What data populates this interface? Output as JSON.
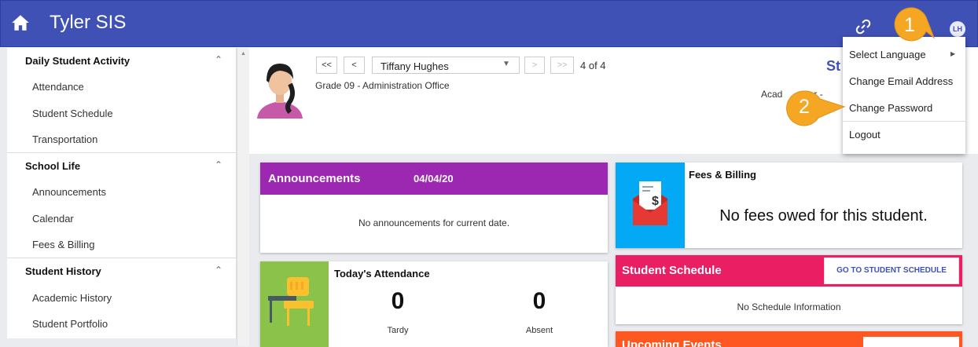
{
  "app": {
    "title": "Tyler SIS",
    "avatar_initials": "LH"
  },
  "sidebar": {
    "sections": [
      {
        "title": "Daily Student Activity",
        "items": [
          "Attendance",
          "Student Schedule",
          "Transportation"
        ]
      },
      {
        "title": "School Life",
        "items": [
          "Announcements",
          "Calendar",
          "Fees & Billing"
        ]
      },
      {
        "title": "Student History",
        "items": [
          "Academic History",
          "Student Portfolio"
        ]
      }
    ]
  },
  "student_nav": {
    "first": "<<",
    "prev": "<",
    "next": ">",
    "last": ">>",
    "selected_student": "Tiffany Hughes",
    "count": "4 of 4",
    "grade": "Grade 09 - Administration Office",
    "page_title_partial": "St",
    "academic_year_partial": "Acad          ar -"
  },
  "announcements": {
    "title": "Announcements",
    "date": "04/04/20",
    "empty": "No announcements for current date."
  },
  "attendance": {
    "title": "Today's Attendance",
    "tardy_count": "0",
    "tardy_label": "Tardy",
    "absent_count": "0",
    "absent_label": "Absent"
  },
  "fees": {
    "title": "Fees & Billing",
    "message": "No fees owed for this student."
  },
  "schedule": {
    "title": "Student Schedule",
    "button": "GO TO STUDENT SCHEDULE",
    "empty": "No Schedule Information"
  },
  "upcoming": {
    "title": "Upcoming Events"
  },
  "user_menu": {
    "items": [
      "Select Language",
      "Change Email Address",
      "Change Password",
      "Logout"
    ]
  },
  "callouts": [
    "1",
    "2"
  ],
  "colors": {
    "header": "#3f51b5",
    "announcements": "#9c27b0",
    "attendance_icon": "#8bc34a",
    "fees_icon": "#03a9f4",
    "schedule": "#e91e63",
    "upcoming": "#ff5722",
    "callout": "#f5a623"
  }
}
